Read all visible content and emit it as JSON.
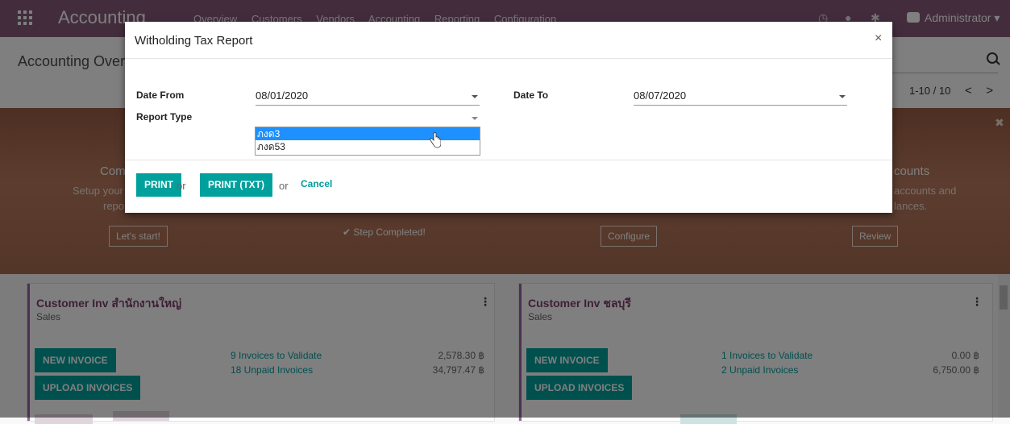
{
  "topbar": {
    "app_name": "Accounting",
    "menu": [
      "Overview",
      "Customers",
      "Vendors",
      "Accounting",
      "Reporting",
      "Configuration"
    ],
    "user": "Administrator",
    "bg_color": "#875a7b"
  },
  "control_panel": {
    "breadcrumb": "Accounting Overview",
    "pager": "1-10 / 10"
  },
  "banner": {
    "left_title": "Com",
    "left_text1": "Setup your",
    "left_text2": "repo",
    "right_title": "counts",
    "right_text1": "accounts and",
    "right_text2": "lances.",
    "lets_start": "Let's start!",
    "step_completed": "✔ Step Completed!",
    "configure": "Configure",
    "review": "Review"
  },
  "cards": [
    {
      "title": "Customer Inv สำนักงานใหญ่",
      "subtitle": "Sales",
      "new_invoice": "NEW INVOICE",
      "upload": "UPLOAD INVOICES",
      "to_validate": "9 Invoices to Validate",
      "to_validate_amount": "2,578.30 ฿",
      "unpaid": "18 Unpaid Invoices",
      "unpaid_amount": "34,797.47 ฿"
    },
    {
      "title": "Customer Inv ชลบุรี",
      "subtitle": "Sales",
      "new_invoice": "NEW INVOICE",
      "upload": "UPLOAD INVOICES",
      "to_validate": "1 Invoices to Validate",
      "to_validate_amount": "0.00 ฿",
      "unpaid": "2 Unpaid Invoices",
      "unpaid_amount": "6,750.00 ฿"
    }
  ],
  "modal": {
    "title": "Witholding Tax Report",
    "date_from_label": "Date From",
    "date_from_value": "08/01/2020",
    "date_to_label": "Date To",
    "date_to_value": "08/07/2020",
    "report_type_label": "Report Type",
    "report_type_options": [
      "ภงด3",
      "ภงด53"
    ],
    "report_type_highlighted": "ภงด3",
    "print": "PRINT",
    "print_txt": "PRINT (TXT)",
    "or": "or",
    "cancel": "Cancel",
    "accent_color": "#00a09d"
  }
}
